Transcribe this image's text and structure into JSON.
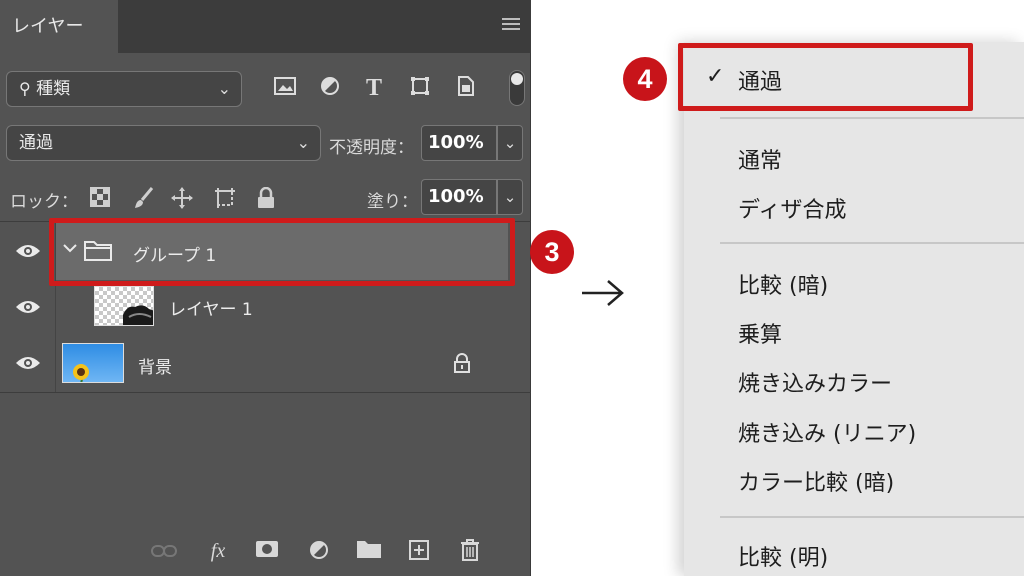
{
  "layers_panel": {
    "tab_title": "レイヤー",
    "filter": {
      "icon": "search-icon",
      "value": "種類",
      "filter_icons": [
        "image-filter-icon",
        "adjustment-filter-icon",
        "type-filter-icon",
        "shape-filter-icon",
        "smart-object-filter-icon"
      ]
    },
    "blend_mode": {
      "value": "通過"
    },
    "opacity": {
      "label": "不透明度：",
      "value": "100%"
    },
    "lock": {
      "label": "ロック：",
      "icons": [
        "lock-transparent-icon",
        "lock-image-icon",
        "lock-position-icon",
        "lock-artboard-icon",
        "lock-all-icon"
      ]
    },
    "fill": {
      "label": "塗り：",
      "value": "100%"
    },
    "layers": [
      {
        "name": "グループ 1",
        "type": "group",
        "visible": true,
        "selected": true
      },
      {
        "name": "レイヤー 1",
        "type": "layer",
        "visible": true
      },
      {
        "name": "背景",
        "type": "background",
        "visible": true,
        "locked": true
      }
    ],
    "bottom_icons": [
      "link-icon",
      "fx-icon",
      "mask-icon",
      "adjustment-icon",
      "folder-icon",
      "new-layer-icon",
      "trash-icon"
    ]
  },
  "annotations": {
    "step3": "3",
    "step4": "4"
  },
  "blend_menu": {
    "selected": "通過",
    "groups": [
      [
        "通過"
      ],
      [
        "通常",
        "ディザ合成"
      ],
      [
        "比較 (暗)",
        "乗算",
        "焼き込みカラー",
        "焼き込み (リニア)",
        "カラー比較 (暗)"
      ],
      [
        "比較 (明)"
      ]
    ]
  },
  "colors": {
    "panel_bg": "#535353",
    "highlight": "#cf1b1b",
    "menu_bg": "#e6e6e6"
  }
}
